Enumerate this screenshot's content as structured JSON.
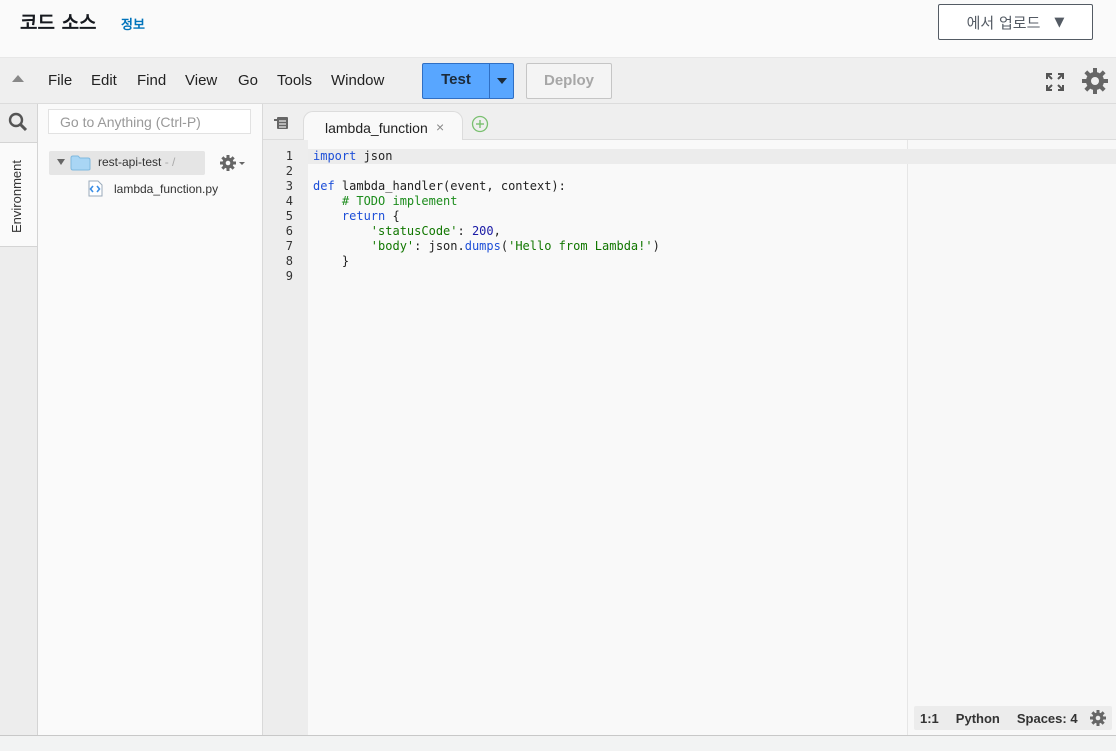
{
  "header": {
    "title": "코드 소스",
    "info_link": "정보",
    "upload_button": "에서 업로드"
  },
  "menubar": {
    "items": [
      "File",
      "Edit",
      "Find",
      "View",
      "Go",
      "Tools",
      "Window"
    ],
    "test_label": "Test",
    "deploy_label": "Deploy"
  },
  "sidebar": {
    "environment_tab": "Environment",
    "goto_placeholder": "Go to Anything (Ctrl-P)",
    "tree_root_name": "rest-api-test",
    "tree_root_suffix": " - /",
    "tree_file_name": "lambda_function.py"
  },
  "editor": {
    "tab_name": "lambda_function",
    "tab_close": "×",
    "line_numbers": [
      "1",
      "2",
      "3",
      "4",
      "5",
      "6",
      "7",
      "8",
      "9"
    ]
  },
  "statusbar": {
    "position": "1:1",
    "language": "Python",
    "spaces": "Spaces: 4"
  },
  "colors": {
    "test_button": "#58a6ff",
    "info_link": "#0073bb",
    "keyword": "#1d4fd8",
    "comment": "#1c8c1c"
  },
  "icons": [
    "collapse-icon",
    "fullscreen-icon",
    "settings-icon",
    "search-icon",
    "folder-icon",
    "gear-icon",
    "python-file-icon",
    "tab-list-icon",
    "add-tab-icon"
  ]
}
